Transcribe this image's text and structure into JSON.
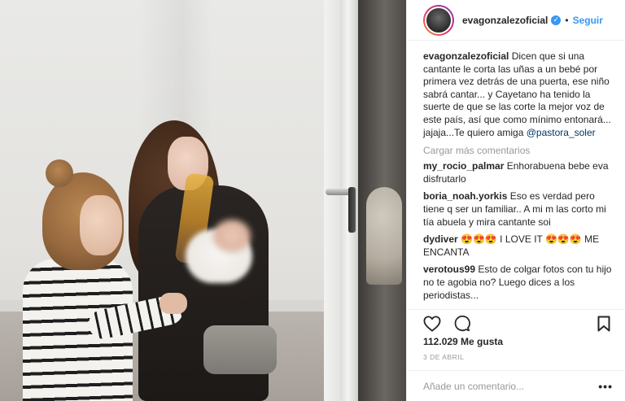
{
  "post": {
    "image_alt": "",
    "username": "evagonzalezoficial",
    "follow_label": "Seguir",
    "dot_separator": "•",
    "caption_username": "evagonzalezoficial",
    "caption_text": " Dicen que si una cantante le corta las uñas a un bebé por primera vez detrás de una puerta, ese niño sabrá cantar... y Cayetano ha tenido la suerte de que se las corte la mejor voz de este país, así que como mínimo entonará... jajaja...Te quiero amiga ",
    "caption_mention": "@pastora_soler",
    "load_more": "Cargar más comentarios",
    "comments": [
      {
        "user": "my_rocio_palmar",
        "text": " Enhorabuena bebe eva disfrutarlo"
      },
      {
        "user": "boria_noah.yorkis",
        "text": " Eso es verdad pero tiene q ser un familiar.. A mi m las corto mi tía abuela y mira cantante soi"
      },
      {
        "user": "dydiver",
        "text": " 😍😍😍 I LOVE IT 😍😍😍 ME ENCANTA"
      },
      {
        "user": "verotous99",
        "text": " Esto de colgar fotos con tu hijo no te agobia no? Luego dices a los periodistas..."
      }
    ],
    "likes": "112.029 Me gusta",
    "date": "3 DE ABRIL",
    "add_comment_placeholder": "Añade un comentario...",
    "more_options": "•••"
  },
  "icons": {
    "like": "heart-icon",
    "comment": "comment-icon",
    "save": "bookmark-icon",
    "verified": "verified-badge-icon"
  },
  "colors": {
    "link": "#3897f0",
    "mention": "#003569",
    "muted": "#999999",
    "text": "#262626"
  }
}
